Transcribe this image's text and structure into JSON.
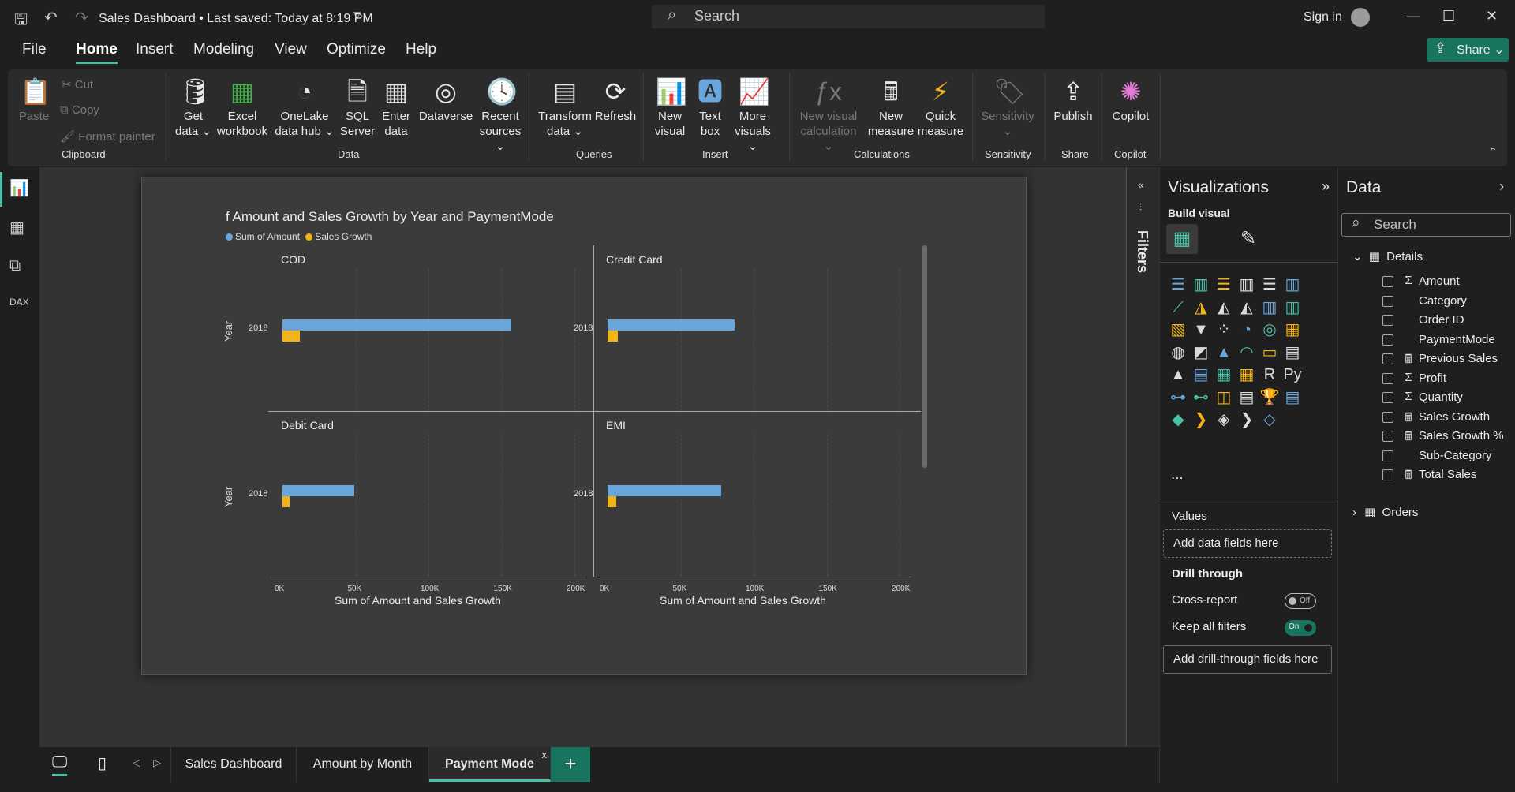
{
  "titlebar": {
    "title": "Sales Dashboard • Last saved: Today at 8:19 PM",
    "search": "Search",
    "signin": "Sign in"
  },
  "menu": {
    "file": "File",
    "home": "Home",
    "insert": "Insert",
    "modeling": "Modeling",
    "view": "View",
    "optimize": "Optimize",
    "help": "Help",
    "share": "Share"
  },
  "ribbon": {
    "paste": "Paste",
    "cut": "Cut",
    "copy": "Copy",
    "format_painter": "Format painter",
    "clipboard": "Clipboard",
    "get_data": "Get data",
    "excel": "Excel workbook",
    "onelake": "OneLake data hub",
    "sql": "SQL Server",
    "enter_data": "Enter data",
    "dataverse": "Dataverse",
    "recent": "Recent sources",
    "data_group": "Data",
    "transform": "Transform data",
    "refresh": "Refresh",
    "queries_group": "Queries",
    "new_visual": "New visual",
    "text_box": "Text box",
    "more_visuals": "More visuals",
    "insert_group": "Insert",
    "new_visual_calc": "New visual calculation",
    "new_measure": "New measure",
    "quick_measure": "Quick measure",
    "calc_group": "Calculations",
    "sensitivity": "Sensitivity",
    "sensitivity_group": "Sensitivity",
    "publish": "Publish",
    "share_group": "Share",
    "copilot": "Copilot",
    "copilot_group": "Copilot"
  },
  "chart": {
    "title": "f Amount and Sales Growth by Year and PaymentMode",
    "legend": [
      "Sum of Amount",
      "Sales Growth"
    ],
    "ylabel": "Year",
    "xlabel": "Sum of Amount and Sales Growth",
    "xticks": [
      "0K",
      "50K",
      "100K",
      "150K",
      "200K"
    ],
    "year": "2018"
  },
  "chart_data": {
    "type": "bar",
    "title": "f Amount and Sales Growth by Year and PaymentMode",
    "xlabel": "Sum of Amount and Sales Growth",
    "ylabel": "Year",
    "xlim": [
      0,
      200000
    ],
    "colors": {
      "Sum of Amount": "#6aa6dc",
      "Sales Growth": "#f2b416"
    },
    "panels": [
      {
        "name": "COD",
        "categories": [
          "2018"
        ],
        "series": [
          {
            "name": "Sum of Amount",
            "values": [
              157000
            ]
          },
          {
            "name": "Sales Growth",
            "values": [
              12000
            ]
          }
        ]
      },
      {
        "name": "Credit Card",
        "categories": [
          "2018"
        ],
        "series": [
          {
            "name": "Sum of Amount",
            "values": [
              87000
            ]
          },
          {
            "name": "Sales Growth",
            "values": [
              7000
            ]
          }
        ]
      },
      {
        "name": "Debit Card",
        "categories": [
          "2018"
        ],
        "series": [
          {
            "name": "Sum of Amount",
            "values": [
              49000
            ]
          },
          {
            "name": "Sales Growth",
            "values": [
              5000
            ]
          }
        ]
      },
      {
        "name": "EMI",
        "categories": [
          "2018"
        ],
        "series": [
          {
            "name": "Sum of Amount",
            "values": [
              78000
            ]
          },
          {
            "name": "Sales Growth",
            "values": [
              6000
            ]
          }
        ]
      }
    ]
  },
  "filters": {
    "label": "Filters"
  },
  "viz": {
    "title": "Visualizations",
    "build": "Build visual",
    "values": "Values",
    "add_data": "Add data fields here",
    "drill": "Drill through",
    "cross": "Cross-report",
    "cross_state": "Off",
    "keep": "Keep all filters",
    "keep_state": "On",
    "add_drill": "Add drill-through fields here"
  },
  "data": {
    "title": "Data",
    "search": "Search",
    "details": "Details",
    "orders": "Orders",
    "fields": [
      {
        "name": "Amount",
        "icon": "sigma-icon"
      },
      {
        "name": "Category",
        "icon": ""
      },
      {
        "name": "Order ID",
        "icon": ""
      },
      {
        "name": "PaymentMode",
        "icon": ""
      },
      {
        "name": "Previous Sales",
        "icon": "calculator-icon"
      },
      {
        "name": "Profit",
        "icon": "sigma-icon"
      },
      {
        "name": "Quantity",
        "icon": "sigma-icon"
      },
      {
        "name": "Sales Growth",
        "icon": "calculator-icon"
      },
      {
        "name": "Sales Growth %",
        "icon": "calculator-icon"
      },
      {
        "name": "Sub-Category",
        "icon": ""
      },
      {
        "name": "Total Sales",
        "icon": "calculator-icon"
      }
    ]
  },
  "tabs": [
    "Sales Dashboard",
    "Amount by Month",
    "Payment Mode"
  ],
  "tab_close": "x",
  "add_tab": "+"
}
